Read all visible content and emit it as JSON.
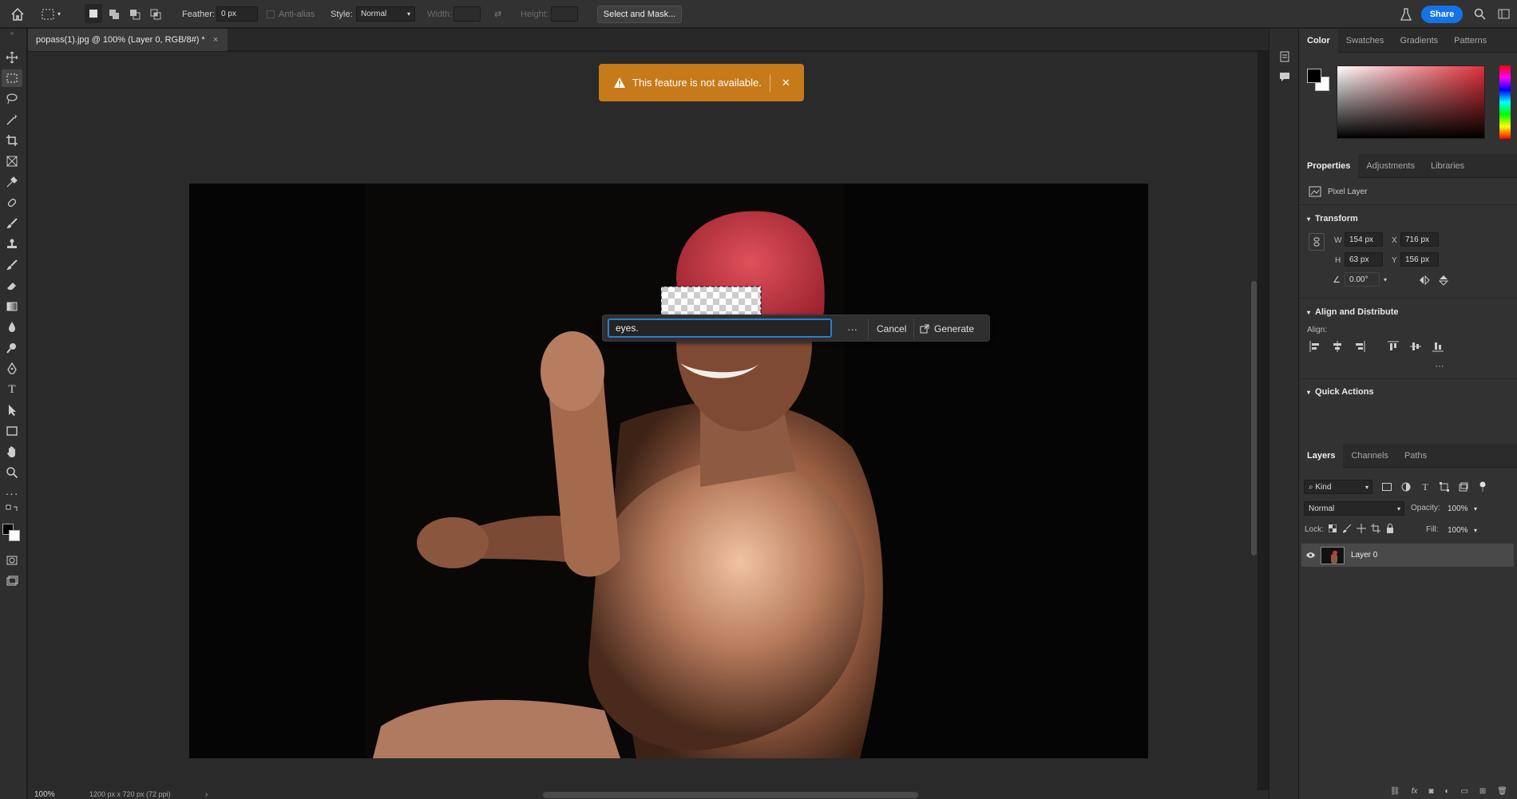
{
  "options_bar": {
    "feather_label": "Feather:",
    "feather_value": "0 px",
    "antialias_label": "Anti-alias",
    "style_label": "Style:",
    "style_value": "Normal",
    "width_label": "Width:",
    "height_label": "Height:",
    "select_mask_label": "Select and Mask...",
    "share_label": "Share"
  },
  "document_tab": {
    "title": "popass(1).jpg @ 100% (Layer 0, RGB/8#) *",
    "close": "×"
  },
  "toast": {
    "message": "This feature is not available.",
    "close": "✕"
  },
  "generate_bar": {
    "prompt_value": "eyes.",
    "more": "···",
    "cancel_label": "Cancel",
    "generate_label": "Generate"
  },
  "status": {
    "zoom": "100%",
    "doc_size": "1200 px x 720 px (72 ppi)",
    "arrow": "›"
  },
  "color_panel": {
    "tabs": [
      "Color",
      "Swatches",
      "Gradients",
      "Patterns"
    ],
    "active_tab": "Color",
    "hue_color": "#e0303a"
  },
  "properties_panel": {
    "tabs": [
      "Properties",
      "Adjustments",
      "Libraries"
    ],
    "active_tab": "Properties",
    "layer_type": "Pixel Layer",
    "transform_label": "Transform",
    "w_label": "W",
    "w_value": "154 px",
    "h_label": "H",
    "h_value": "63 px",
    "x_label": "X",
    "x_value": "716 px",
    "y_label": "Y",
    "y_value": "156 px",
    "angle_value": "0.00°",
    "align_section": "Align and Distribute",
    "align_label": "Align:",
    "more": "···",
    "quick_actions": "Quick Actions"
  },
  "layers_panel": {
    "tabs": [
      "Layers",
      "Channels",
      "Paths"
    ],
    "active_tab": "Layers",
    "kind_label": "Kind",
    "blend_mode": "Normal",
    "opacity_label": "Opacity:",
    "opacity_value": "100%",
    "lock_label": "Lock:",
    "fill_label": "Fill:",
    "fill_value": "100%",
    "layers": [
      {
        "name": "Layer 0",
        "visible": true
      }
    ]
  },
  "colors": {
    "accent_share": "#1473e6",
    "toast_bg": "#c77a1a",
    "selection_active": "#2d7bd4"
  }
}
